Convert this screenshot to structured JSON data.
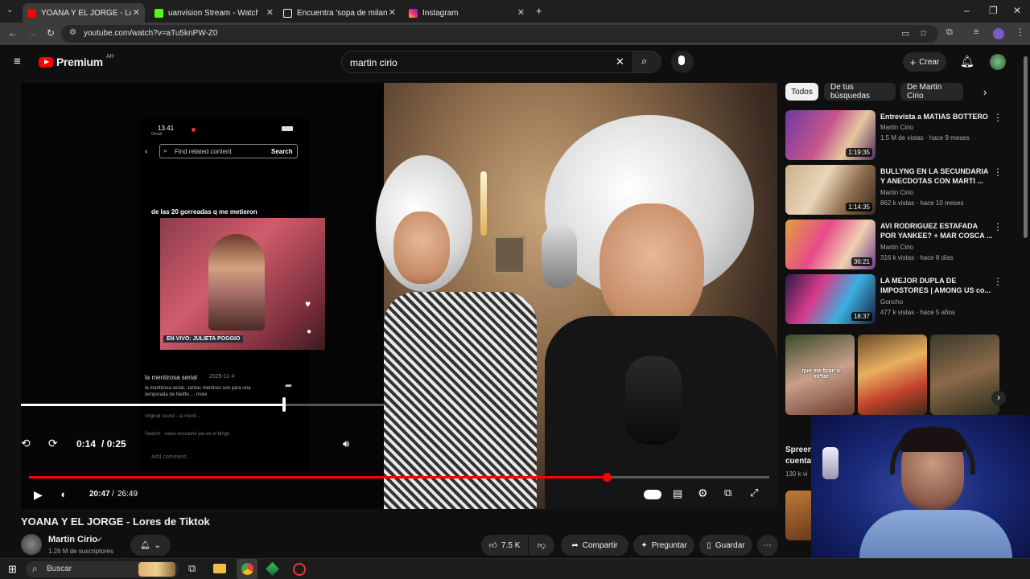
{
  "browser": {
    "tabs": [
      {
        "title": "YOANA Y EL JORGE - Lores de Tiktok",
        "favicon_color": "#ff0000",
        "active": true
      },
      {
        "title": "uanvision Stream - Watch Live",
        "favicon_color": "#53fc18",
        "active": false
      },
      {
        "title": "Encuentra 'sopa de milanesa yo'",
        "favicon_color": "#ffffff",
        "active": false
      },
      {
        "title": "Instagram",
        "favicon_color": "#e1306c",
        "active": false
      }
    ],
    "url": "youtube.com/watch?v=aTu5knPW-Z0"
  },
  "masthead": {
    "logo_text": "Premium",
    "region": "AR",
    "search_value": "martin cirio",
    "create_label": "Crear"
  },
  "player": {
    "inner": {
      "status_time": "13.41",
      "status_app": "Gmail",
      "search_placeholder": "Find related content",
      "search_button": "Search",
      "clip_caption": "de las 20 gorreadas q me metieron",
      "clip_banner": "EN VIVO: JULIETA POGGIO",
      "post_user": "la mentirosa serial",
      "post_date": "2025-11-4",
      "post_desc": "la mentirosa serial...tantas mentiras son para una temporada de Netflix.... more",
      "post_sound": "original sound - la menti...",
      "search_hint": "Search · video escrache joa en el bingo",
      "comment_placeholder": "Add comment...",
      "time_current": "0:14",
      "time_total": "/ 0:25",
      "progress": 0.72
    },
    "time_current": "20:47",
    "time_total": "26:49",
    "progress": 0.78
  },
  "video": {
    "title": "YOANA Y EL JORGE - Lores de Tiktok",
    "channel": "Martin Cirio",
    "subscribers": "1.26 M de suscriptores",
    "likes": "7.5 K",
    "share": "Compartir",
    "ask": "Preguntar",
    "save": "Guardar"
  },
  "sidebar": {
    "chips": [
      "Todos",
      "De tus búsquedas",
      "De Martin Cirio"
    ],
    "recommendations": [
      {
        "title": "Entrevista a MATIAS BOTTERO",
        "channel": "Martin Cirio",
        "meta": "1.5 M de vistas · hace 9 meses",
        "duration": "1:19:35"
      },
      {
        "title": "BULLYNG EN LA SECUNDARIA Y ANECDOTAS CON MARTI ...",
        "channel": "Martin Cirio",
        "meta": "862 k vistas · hace 10 meses",
        "duration": "1:14:35"
      },
      {
        "title": "AVI RODRIGUEZ ESTAFADA POR YANKEE? + MAR COSCA ...",
        "channel": "Martin Cirio",
        "meta": "316 k vistas · hace 8 días",
        "duration": "36:21"
      },
      {
        "title": "LA MEJOR DUPLA DE IMPOSTORES | AMONG US co...",
        "channel": "Goncho",
        "meta": "477 k vistas · hace 5 años",
        "duration": "18:37"
      }
    ],
    "shorts_caption": "que me tiran a mi*tar",
    "partial_title": "Spreen",
    "partial_title2": "cuenta",
    "partial_meta": "130 k vi"
  },
  "taskbar": {
    "search_label": "Buscar"
  }
}
